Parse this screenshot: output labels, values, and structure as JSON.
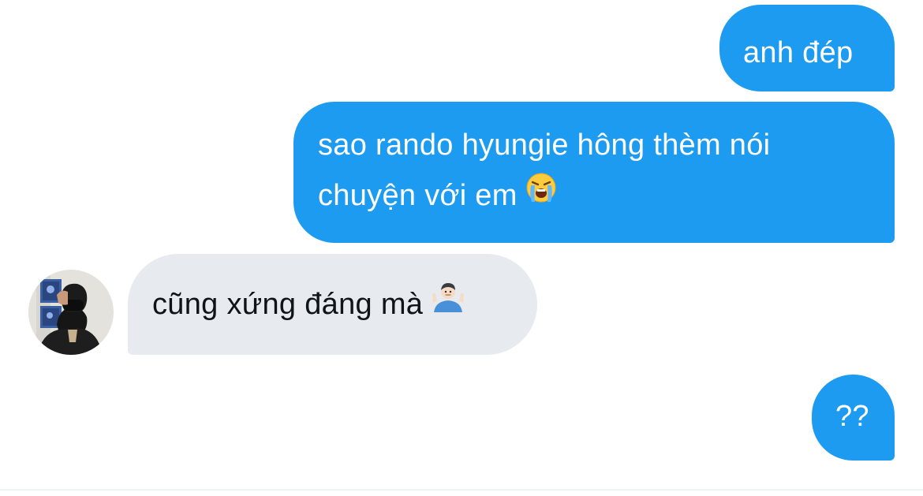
{
  "conversation": {
    "messages": [
      {
        "direction": "outgoing",
        "text": "anh đép"
      },
      {
        "direction": "outgoing",
        "line1": "sao rando hyungie hông thèm nói",
        "line2": "chuyện với em",
        "emoji": "loudly-crying-face-emoji"
      },
      {
        "direction": "incoming",
        "text": "cũng xứng đáng mà",
        "emoji": "man-shrugging-emoji"
      },
      {
        "direction": "outgoing",
        "text": "??"
      }
    ],
    "participant": {
      "avatar": "avatar-person-covering-face"
    }
  },
  "colors": {
    "outgoing_bubble": "#1d9bf0",
    "outgoing_text": "#ffffff",
    "incoming_bubble": "#e7ebef",
    "incoming_text": "#0f1419",
    "background": "#ffffff"
  }
}
